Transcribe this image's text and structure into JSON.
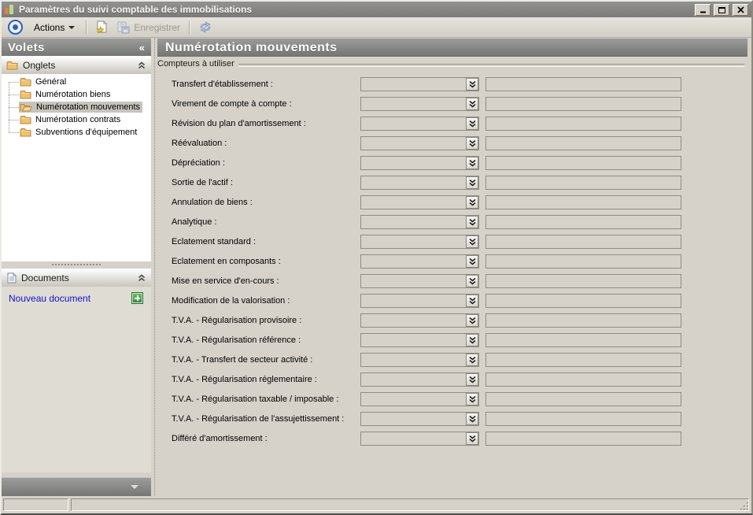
{
  "window": {
    "title": "Paramètres du suivi comptable des immobilisations"
  },
  "toolbar": {
    "actions_label": "Actions",
    "save_label": "Enregistrer"
  },
  "sidebar": {
    "title": "Volets",
    "collapse_glyph": "«",
    "onglets": {
      "label": "Onglets",
      "items": [
        {
          "label": "Général",
          "selected": false
        },
        {
          "label": "Numérotation biens",
          "selected": false
        },
        {
          "label": "Numérotation mouvements",
          "selected": true
        },
        {
          "label": "Numérotation contrats",
          "selected": false
        },
        {
          "label": "Subventions d'équipement",
          "selected": false
        }
      ]
    },
    "documents": {
      "label": "Documents",
      "new_document_label": "Nouveau document"
    }
  },
  "main": {
    "title": "Numérotation mouvements",
    "group_label": "Compteurs à utiliser",
    "combo_value": "",
    "field_value": "",
    "rows": [
      {
        "label": "Transfert d'établissement :"
      },
      {
        "label": "Virement de compte à compte :"
      },
      {
        "label": "Révision du plan d'amortissement :"
      },
      {
        "label": "Réévaluation :"
      },
      {
        "label": "Dépréciation :"
      },
      {
        "label": "Sortie de l'actif :"
      },
      {
        "label": "Annulation de biens :"
      },
      {
        "label": "Analytique :"
      },
      {
        "label": "Eclatement standard :"
      },
      {
        "label": "Eclatement en composants :"
      },
      {
        "label": "Mise en service d'en-cours :"
      },
      {
        "label": "Modification de la valorisation :"
      },
      {
        "label": "T.V.A. - Régularisation provisoire :"
      },
      {
        "label": "T.V.A. - Régularisation référence :"
      },
      {
        "label": "T.V.A. - Transfert de secteur activité :"
      },
      {
        "label": "T.V.A. - Régularisation réglementaire :"
      },
      {
        "label": "T.V.A. - Régularisation taxable / imposable :"
      },
      {
        "label": "T.V.A. - Régularisation de l'assujettissement :"
      },
      {
        "label": "Différé d'amortissement :"
      }
    ]
  },
  "status_bar": {
    "left_text": "",
    "right_text": ""
  },
  "colors": {
    "window_bg": "#d6d2c9",
    "header_bar_top": "#9b9b99",
    "header_bar_bottom": "#747472",
    "selection_bg": "#c7c4bb",
    "link_blue": "#1212cc",
    "folder_yellow": "#f0c168",
    "add_button_green": "#2f8a33"
  }
}
